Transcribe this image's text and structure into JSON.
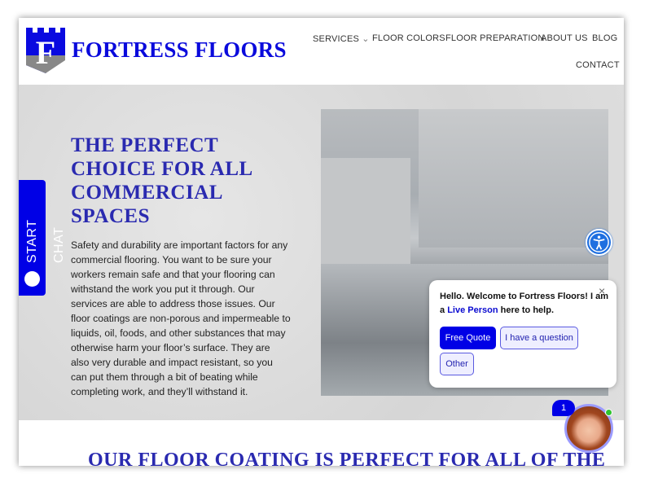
{
  "brand": {
    "name": "FORTRESS FLOORS",
    "logo_letter": "F",
    "color": "#0a0adc"
  },
  "nav": {
    "items": [
      {
        "label": "SERVICES",
        "has_dropdown": true
      },
      {
        "label": "FLOOR COLORS"
      },
      {
        "label": "FLOOR PREPARATION"
      },
      {
        "label": "ABOUT US"
      },
      {
        "label": "BLOG"
      },
      {
        "label": "CONTACT"
      }
    ]
  },
  "hero": {
    "title": "THE PERFECT CHOICE FOR ALL COMMERCIAL SPACES",
    "body": "Safety and durability are important factors for any commercial flooring. You want to be sure your workers remain safe and that your flooring can withstand the work you put it through. Our services are able to address those issues. Our floor coatings are non-porous and impermeable to liquids, oil, foods, and other substances that may otherwise harm your floor’s surface. They are also very durable and impact resistant, so you can put them through a bit of beating while completing work, and they’ll withstand it."
  },
  "section2": {
    "title": "OUR FLOOR COATING IS PERFECT FOR ALL OF THE"
  },
  "start_chat": {
    "label": "START CHAT",
    "icon": "chat-bubble-icon"
  },
  "accessibility": {
    "icon": "accessibility-icon"
  },
  "chat": {
    "message_pre": "Hello. Welcome to Fortress Floors! I am a ",
    "message_link": "Live Person",
    "message_post": " here to help.",
    "buttons": [
      "Free Quote",
      "I have a question",
      "Other"
    ],
    "close": "×",
    "badge_count": "1",
    "accent": "#0000e6",
    "online_color": "#2ec42e"
  }
}
